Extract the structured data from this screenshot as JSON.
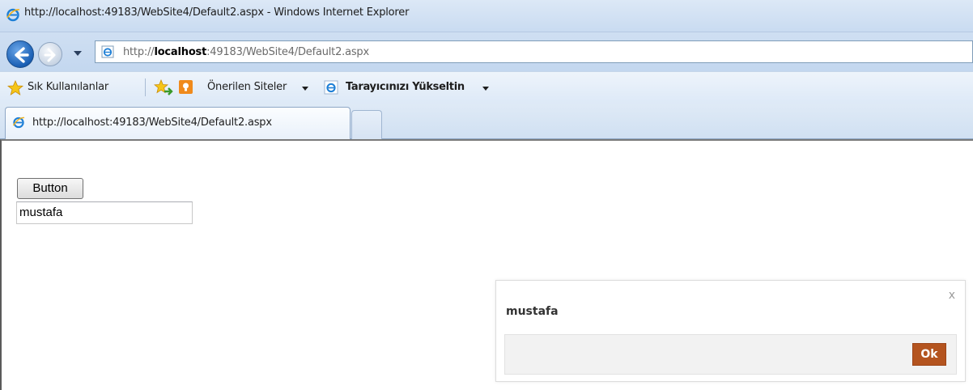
{
  "window": {
    "title": "http://localhost:49183/WebSite4/Default2.aspx - Windows Internet Explorer"
  },
  "address_bar": {
    "url_prefix": "http://",
    "url_host": "localhost",
    "url_rest": ":49183/WebSite4/Default2.aspx"
  },
  "favorites_bar": {
    "favorites_label": "Sık Kullanılanlar",
    "suggested_sites_label": "Önerilen Siteler",
    "upgrade_label": "Tarayıcınızı Yükseltin"
  },
  "tabs": [
    {
      "label": "http://localhost:49183/WebSite4/Default2.aspx",
      "active": true
    }
  ],
  "page": {
    "button_label": "Button",
    "input_value": "mustafa"
  },
  "dialog": {
    "close_label": "x",
    "message": "mustafa",
    "ok_label": "Ok"
  },
  "colors": {
    "ok_button": "#b4541f",
    "chrome_blue": "#c9dbf1"
  }
}
